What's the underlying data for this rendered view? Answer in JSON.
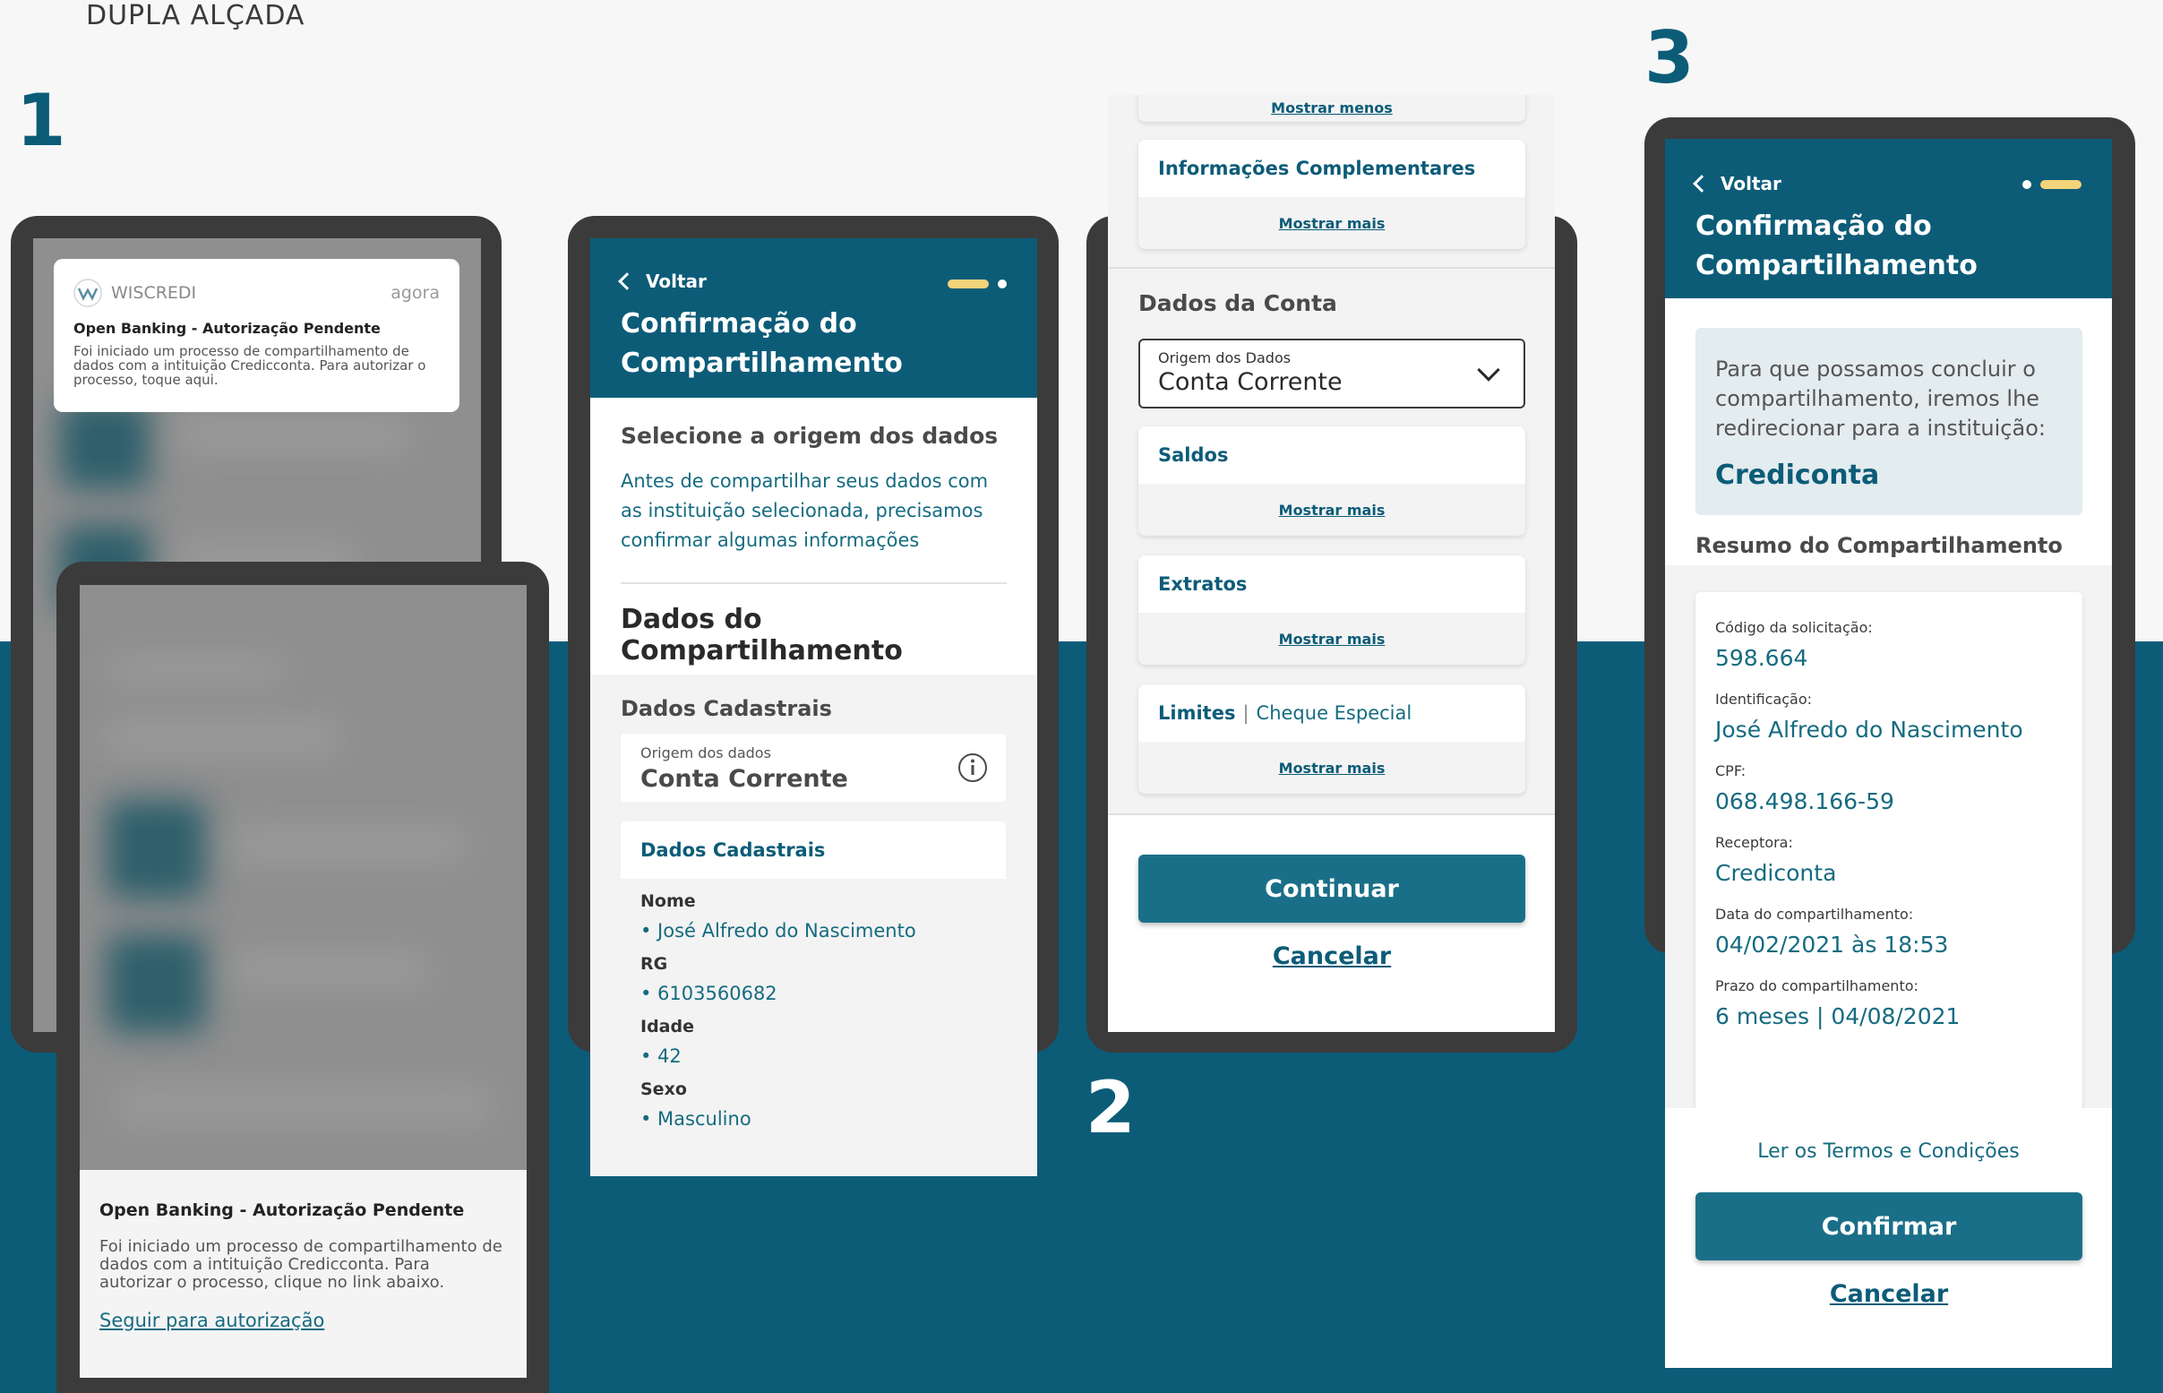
{
  "page": {
    "title": "DUPLA ALÇADA"
  },
  "steps": {
    "one": "1",
    "two": "2",
    "three": "3"
  },
  "notification": {
    "app": "WISCREDI",
    "time": "agora",
    "title": "Open Banking - Autorização Pendente",
    "body": "Foi iniciado um processo de compartilhamento de dados com a intituição Credicconta. Para autorizar o processo, toque aqui."
  },
  "sheet": {
    "title": "Open Banking - Autorização Pendente",
    "body": "Foi iniciado um processo de compartilhamento de dados com a intituição Credicconta. Para autorizar o processo, clique no link abaixo.",
    "link": "Seguir para autorização"
  },
  "screen2a": {
    "back": "Voltar",
    "title_line1": "Confirmação do",
    "title_line2": "Compartilhamento",
    "select_heading": "Selecione a origem dos dados",
    "intro": "Antes de compartilhar seus dados com as instituição selecionada, precisamos confirmar algumas informações",
    "data_heading": "Dados do Compartilhamento",
    "cadastrais_heading": "Dados Cadastrais",
    "origin_label": "Origem dos dados",
    "origin_value": "Conta Corrente",
    "card_title": "Dados Cadastrais",
    "fields": [
      {
        "label": "Nome",
        "value": "• José Alfredo do Nascimento"
      },
      {
        "label": "RG",
        "value": "• 6103560682"
      },
      {
        "label": "Idade",
        "value": "• 42"
      },
      {
        "label": "Sexo",
        "value": "• Masculino"
      }
    ]
  },
  "screen2b": {
    "show_less": "Mostrar menos",
    "info_card": "Informações Complementares",
    "show_more": "Mostrar mais",
    "account_heading": "Dados da Conta",
    "select_label": "Origem dos Dados",
    "select_value": "Conta Corrente",
    "saldos": "Saldos",
    "extratos": "Extratos",
    "limites": "Limites",
    "limites_sep": "|",
    "limites_sub": "Cheque Especial",
    "continue": "Continuar",
    "cancel": "Cancelar"
  },
  "screen3": {
    "back": "Voltar",
    "title_line1": "Confirmação do",
    "title_line2": "Compartilhamento",
    "info_text": "Para que possamos concluir o compartilhamento, iremos lhe redirecionar para a instituição:",
    "institution": "Crediconta",
    "summary_heading": "Resumo do Compartilhamento",
    "summary": [
      {
        "label": "Código da solicitação:",
        "value": "598.664"
      },
      {
        "label": "Identificação:",
        "value": "José Alfredo do Nascimento"
      },
      {
        "label": "CPF:",
        "value": "068.498.166-59"
      },
      {
        "label": "Receptora:",
        "value": "Crediconta"
      },
      {
        "label": "Data do compartilhamento:",
        "value": "04/02/2021 às 18:53"
      },
      {
        "label": "Prazo do compartilhamento:",
        "value": "6 meses | 04/08/2021"
      }
    ],
    "terms": "Ler os Termos e Condições",
    "confirm": "Confirmar",
    "cancel": "Cancelar"
  },
  "colors": {
    "brand": "#0c5c78",
    "accent": "#f2d47a",
    "button": "#1a6f88"
  }
}
